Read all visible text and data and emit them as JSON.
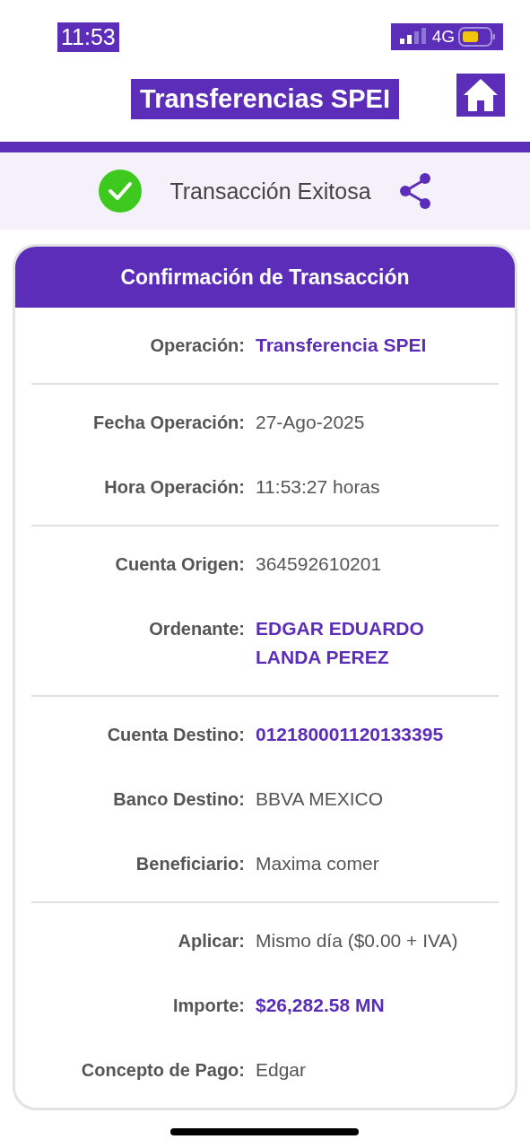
{
  "status_bar": {
    "time": "11:53",
    "network": "4G"
  },
  "header": {
    "title": "Transferencias SPEI"
  },
  "result": {
    "message": "Transacción Exitosa"
  },
  "card": {
    "title": "Confirmación de Transacción",
    "groups": [
      [
        {
          "label": "Operación:",
          "value": "Transferencia SPEI",
          "emphasis": true
        }
      ],
      [
        {
          "label": "Fecha Operación:",
          "value": "27-Ago-2025",
          "emphasis": false
        },
        {
          "label": "Hora Operación:",
          "value": "11:53:27 horas",
          "emphasis": false
        }
      ],
      [
        {
          "label": "Cuenta Origen:",
          "value": "364592610201",
          "emphasis": false
        },
        {
          "label": "Ordenante:",
          "value": "EDGAR EDUARDO LANDA PEREZ",
          "emphasis": true
        }
      ],
      [
        {
          "label": "Cuenta Destino:",
          "value": "012180001120133395",
          "emphasis": true
        },
        {
          "label": "Banco Destino:",
          "value": "BBVA MEXICO",
          "emphasis": false
        },
        {
          "label": "Beneficiario:",
          "value": "Maxima comer",
          "emphasis": false
        }
      ],
      [
        {
          "label": "Aplicar:",
          "value": "Mismo día ($0.00 + IVA)",
          "emphasis": false
        },
        {
          "label": "Importe:",
          "value": "$26,282.58 MN",
          "emphasis": true
        },
        {
          "label": "Concepto de Pago:",
          "value": "Edgar",
          "emphasis": false
        }
      ]
    ]
  }
}
